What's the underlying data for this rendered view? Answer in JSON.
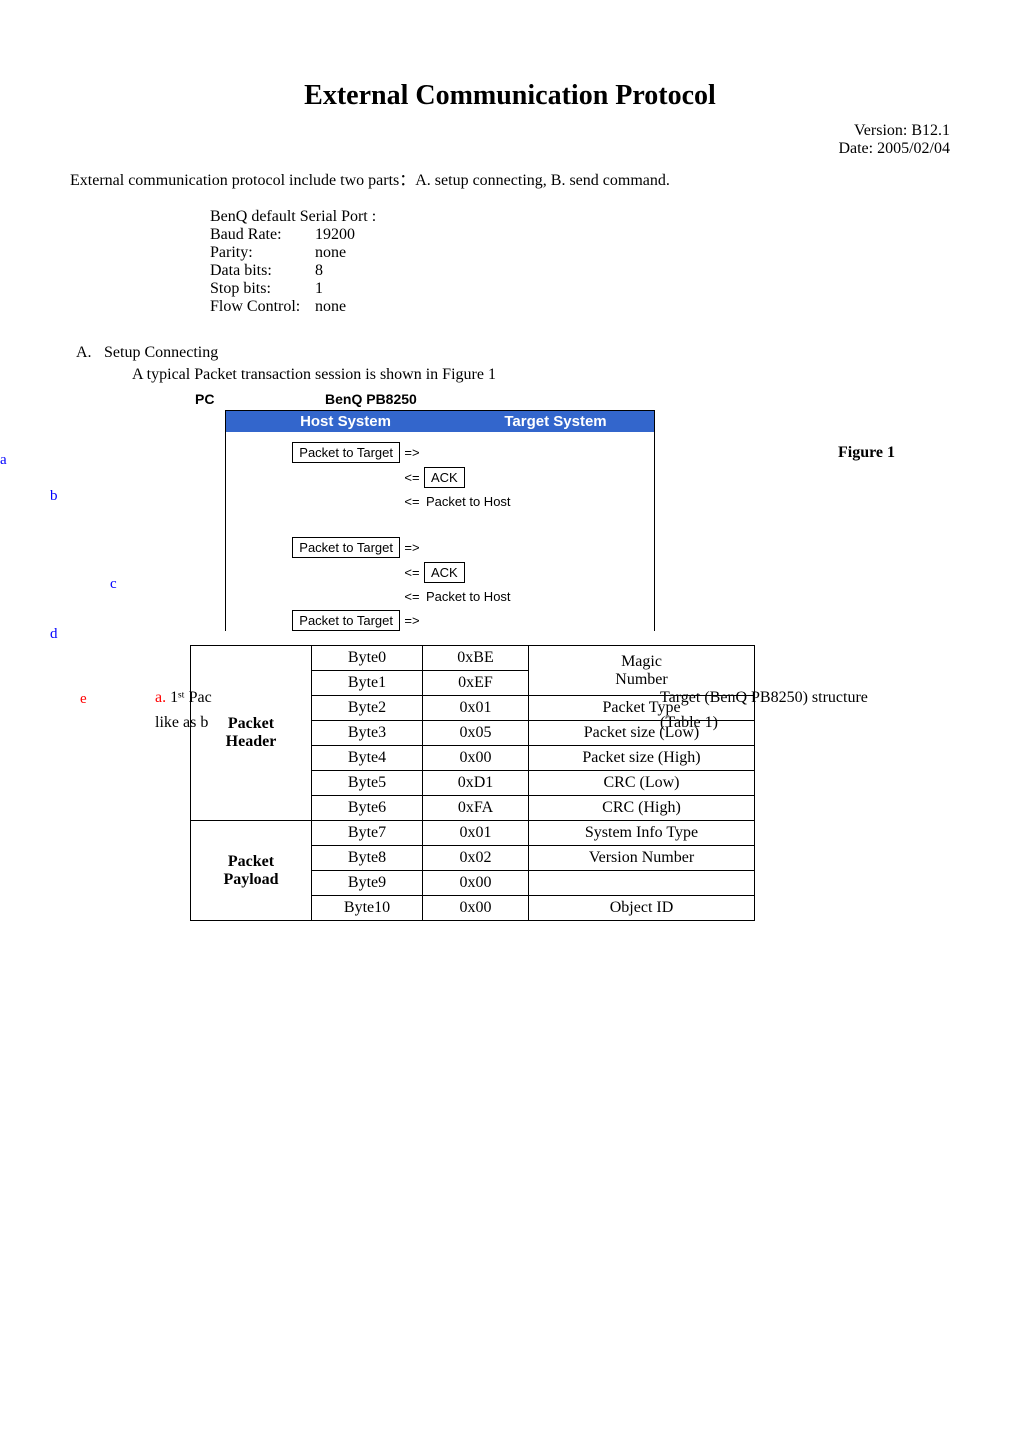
{
  "title": "External Communication Protocol",
  "meta": {
    "version": "Version: B12.1",
    "date": "Date: 2005/02/04"
  },
  "intro": "External communication protocol include two parts：A. setup connecting, B. send command.",
  "serial": {
    "heading": "BenQ default Serial Port :",
    "rows": [
      {
        "label": "Baud Rate:",
        "value": "19200"
      },
      {
        "label": "Parity:",
        "value": "none"
      },
      {
        "label": "Data bits:",
        "value": "8"
      },
      {
        "label": "Stop bits:",
        "value": "1"
      },
      {
        "label": "Flow Control:",
        "value": "none"
      }
    ]
  },
  "section_a": {
    "letter": "A.",
    "title": "Setup Connecting",
    "desc": "A typical Packet transaction session is shown in Figure 1"
  },
  "diagram": {
    "pc": "PC",
    "benq": "BenQ PB8250",
    "host": "Host System",
    "target": "Target System",
    "ptt": "Packet to Target",
    "ack": "ACK",
    "pth": "Packet to Host",
    "arr_r": "=>",
    "arr_l": "<=",
    "figure_label": "Figure 1",
    "annots": {
      "a": "a",
      "b": "b",
      "c": "c",
      "d": "d",
      "e": "e"
    },
    "overlap_a_prefix": "a.",
    "overlap_a_text": " 1ˢᵗ Pac",
    "overlap_line2": "like as b",
    "right_tail1": " Target (BenQ PB8250) structure",
    "right_tail2": " (Table 1)"
  },
  "table": {
    "ref": "(Table 1)",
    "groups": [
      {
        "name": "Packet Header",
        "rows": [
          {
            "byte": "Byte0",
            "val": "0xBE",
            "desc": "Magic",
            "rowspan_desc": 2,
            "desc_full": "Number"
          },
          {
            "byte": "Byte1",
            "val": "0xEF",
            "desc": "Number"
          },
          {
            "byte": "Byte2",
            "val": "0x01",
            "desc": "Packet Type"
          },
          {
            "byte": "Byte3",
            "val": "0x05",
            "desc": "Packet size (Low)"
          },
          {
            "byte": "Byte4",
            "val": "0x00",
            "desc": "Packet size (High)"
          },
          {
            "byte": "Byte5",
            "val": "0xD1",
            "desc": "CRC (Low)"
          },
          {
            "byte": "Byte6",
            "val": "0xFA",
            "desc": "CRC (High)"
          }
        ]
      },
      {
        "name": "Packet Payload",
        "rows": [
          {
            "byte": "Byte7",
            "val": "0x01",
            "desc": "System Info Type"
          },
          {
            "byte": "Byte8",
            "val": "0x02",
            "desc": "Version Number"
          },
          {
            "byte": "Byte9",
            "val": "0x00",
            "desc": ""
          },
          {
            "byte": "Byte10",
            "val": "0x00",
            "desc": "Object ID"
          }
        ]
      }
    ]
  }
}
